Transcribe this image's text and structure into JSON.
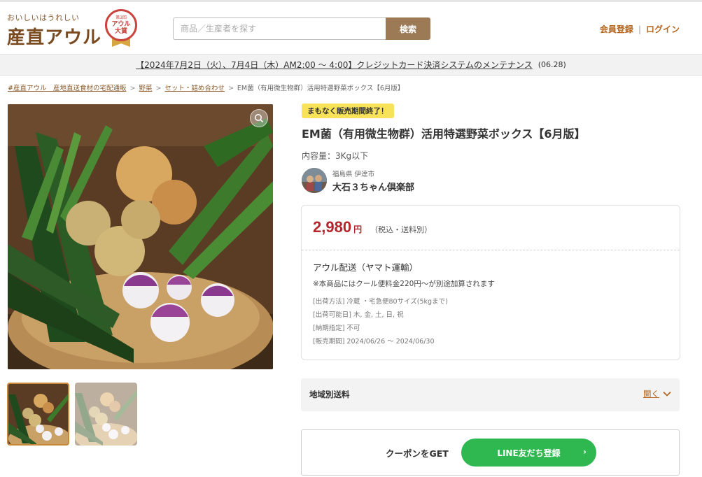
{
  "header": {
    "logo_tagline": "おいしいはうれしい",
    "logo_text": "産直アウル",
    "award_small": "第3回",
    "award_line1": "アウル",
    "award_line2": "大賞",
    "search_placeholder": "商品／生産者を探す",
    "search_button": "検索",
    "register": "会員登録",
    "separator": "|",
    "login": "ログイン"
  },
  "notice": {
    "text": "【2024年7月2日（火）、7月4日（木）AM2:00 ～ 4:00】クレジットカード決済システムのメンテナンス",
    "date": "(06.28)"
  },
  "breadcrumb": [
    {
      "label": "#産直アウル　産地直送食材の宅配通販",
      "link": true
    },
    {
      "label": "野菜",
      "link": true
    },
    {
      "label": "セット・詰め合わせ",
      "link": true
    },
    {
      "label": "EM菌（有用微生物群）活用特選野菜ボックス【6月版】",
      "link": false
    }
  ],
  "product": {
    "badge": "まもなく販売期間終了！",
    "title": "EM菌（有用微生物群）活用特選野菜ボックス【6月版】",
    "capacity": "内容量：3Kg以下",
    "producer_location": "福島県 伊達市",
    "producer_name": "大石３ちゃん倶楽部"
  },
  "price": {
    "value": "2,980",
    "unit": "円",
    "note": "（税込・送料別）"
  },
  "shipping": {
    "title": "アウル配送（ヤマト運輸）",
    "note": "※本商品にはクール便料金220円〜が別途加算されます",
    "details": [
      "[出荷方法] 冷蔵 ・宅急便80サイズ(5kgまで)",
      "[出荷可能日] 木, 金, 土, 日, 祝",
      "[納期指定] 不可",
      "[販売期間] 2024/06/26 ～ 2024/06/30"
    ]
  },
  "region_fee": {
    "label": "地域別送料",
    "open": "開く"
  },
  "coupon": {
    "label": "クーポンをGET",
    "button": "LINE友だち登録"
  },
  "icons": {
    "zoom": "zoom-icon",
    "chevron": "chevron-down-icon",
    "arrow": "arrow-right-icon"
  },
  "colors": {
    "brand_brown": "#7a4a20",
    "search_button": "#9c7a55",
    "link_orange": "#b5651d",
    "price_red": "#b3262c",
    "badge_yellow": "#f7e25a",
    "line_green": "#2fb84f"
  }
}
